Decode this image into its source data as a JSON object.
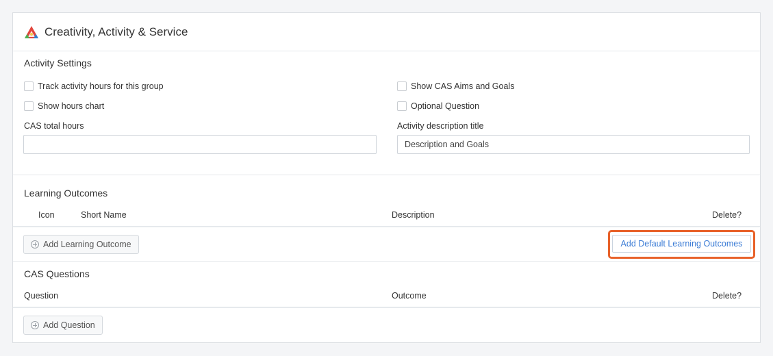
{
  "header": {
    "title": "Creativity, Activity & Service",
    "logo_icon": "cas-triangle-icon"
  },
  "activity_settings": {
    "title": "Activity Settings",
    "track_hours_label": "Track activity hours for this group",
    "show_hours_chart_label": "Show hours chart",
    "show_aims_label": "Show CAS Aims and Goals",
    "optional_question_label": "Optional Question",
    "total_hours_label": "CAS total hours",
    "total_hours_value": "",
    "description_title_label": "Activity description title",
    "description_title_value": "Description and Goals"
  },
  "learning_outcomes": {
    "title": "Learning Outcomes",
    "columns": [
      "Icon",
      "Short Name",
      "Description",
      "Delete?"
    ],
    "add_label": "Add Learning Outcome",
    "add_default_label": "Add Default Learning Outcomes"
  },
  "cas_questions": {
    "title": "CAS Questions",
    "columns": [
      "Question",
      "Outcome",
      "Delete?"
    ],
    "add_label": "Add Question"
  },
  "colors": {
    "accent": "#3a7bd5",
    "highlight": "#e8622a",
    "logo_red": "#e2453c",
    "logo_green": "#4caf50",
    "logo_blue": "#2f80d1"
  }
}
